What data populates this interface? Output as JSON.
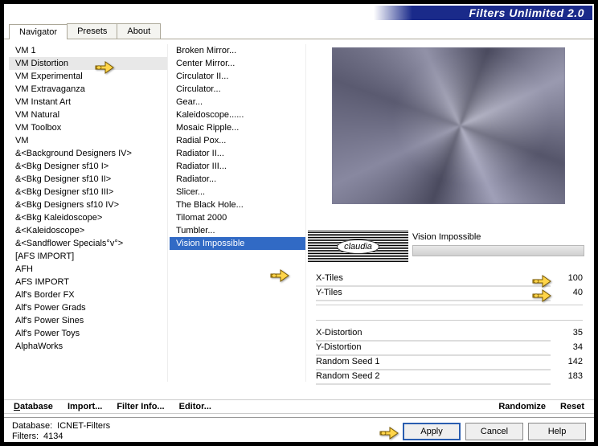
{
  "title": "Filters Unlimited 2.0",
  "tabs": [
    {
      "label": "Navigator",
      "active": true
    },
    {
      "label": "Presets",
      "active": false
    },
    {
      "label": "About",
      "active": false
    }
  ],
  "categories": [
    "VM 1",
    "VM Distortion",
    "VM Experimental",
    "VM Extravaganza",
    "VM Instant Art",
    "VM Natural",
    "VM Toolbox",
    "VM",
    "&<Background Designers IV>",
    "&<Bkg Designer sf10 I>",
    "&<Bkg Designer sf10 II>",
    "&<Bkg Designer sf10 III>",
    "&<Bkg Designers sf10 IV>",
    "&<Bkg Kaleidoscope>",
    "&<Kaleidoscope>",
    "&<Sandflower Specials°v°>",
    "[AFS IMPORT]",
    "AFH",
    "AFS IMPORT",
    "Alf's Border FX",
    "Alf's Power Grads",
    "Alf's Power Sines",
    "Alf's Power Toys",
    "AlphaWorks"
  ],
  "categories_hover_index": 1,
  "filters": [
    "Broken Mirror...",
    "Center Mirror...",
    "Circulator II...",
    "Circulator...",
    "Gear...",
    "Kaleidoscope......",
    "Mosaic Ripple...",
    "Radial Pox...",
    "Radiator II...",
    "Radiator III...",
    "Radiator...",
    "Slicer...",
    "The Black Hole...",
    "Tilomat 2000",
    "Tumbler...",
    "Vision Impossible"
  ],
  "filters_selected_index": 15,
  "watermark": "claudia",
  "current_filter_label": "Vision Impossible",
  "params_group1": [
    {
      "name": "X-Tiles",
      "value": 100
    },
    {
      "name": "Y-Tiles",
      "value": 40
    }
  ],
  "params_group2": [
    {
      "name": "X-Distortion",
      "value": 35
    },
    {
      "name": "Y-Distortion",
      "value": 34
    },
    {
      "name": "Random Seed 1",
      "value": 142
    },
    {
      "name": "Random Seed 2",
      "value": 183
    }
  ],
  "bottom_links": {
    "database": "Database",
    "import": "Import...",
    "filter_info": "Filter Info...",
    "editor": "Editor...",
    "randomize": "Randomize",
    "reset": "Reset"
  },
  "status": {
    "db_label": "Database:",
    "db_value": "ICNET-Filters",
    "filters_label": "Filters:",
    "filters_value": "4134"
  },
  "buttons": {
    "apply": "Apply",
    "cancel": "Cancel",
    "help": "Help"
  }
}
